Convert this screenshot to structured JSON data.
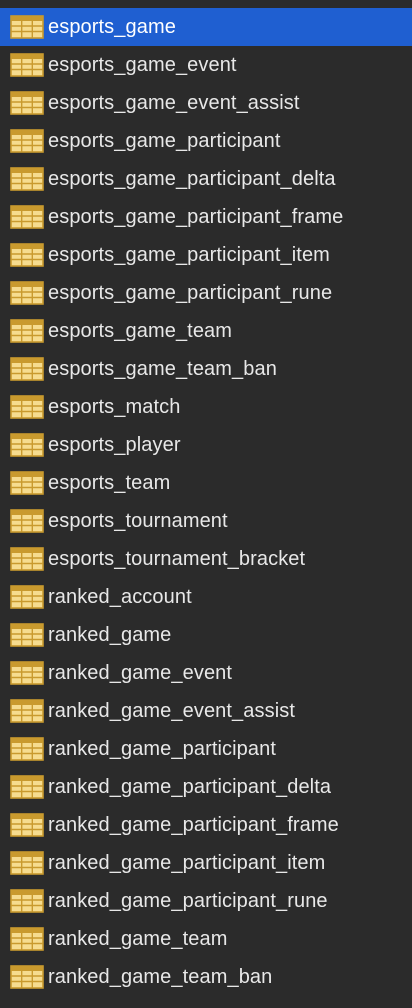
{
  "colors": {
    "background": "#2b2b2b",
    "selected": "#1f5fd1",
    "text": "#e8e8e8",
    "icon_fill": "#f6dc8f",
    "icon_grid": "#c99a2e"
  },
  "selected_index": 0,
  "tables": [
    {
      "name": "esports_game",
      "icon": "table-icon"
    },
    {
      "name": "esports_game_event",
      "icon": "table-icon"
    },
    {
      "name": "esports_game_event_assist",
      "icon": "table-icon"
    },
    {
      "name": "esports_game_participant",
      "icon": "table-icon"
    },
    {
      "name": "esports_game_participant_delta",
      "icon": "table-icon"
    },
    {
      "name": "esports_game_participant_frame",
      "icon": "table-icon"
    },
    {
      "name": "esports_game_participant_item",
      "icon": "table-icon"
    },
    {
      "name": "esports_game_participant_rune",
      "icon": "table-icon"
    },
    {
      "name": "esports_game_team",
      "icon": "table-icon"
    },
    {
      "name": "esports_game_team_ban",
      "icon": "table-icon"
    },
    {
      "name": "esports_match",
      "icon": "table-icon"
    },
    {
      "name": "esports_player",
      "icon": "table-icon"
    },
    {
      "name": "esports_team",
      "icon": "table-icon"
    },
    {
      "name": "esports_tournament",
      "icon": "table-icon"
    },
    {
      "name": "esports_tournament_bracket",
      "icon": "table-icon"
    },
    {
      "name": "ranked_account",
      "icon": "table-icon"
    },
    {
      "name": "ranked_game",
      "icon": "table-icon"
    },
    {
      "name": "ranked_game_event",
      "icon": "table-icon"
    },
    {
      "name": "ranked_game_event_assist",
      "icon": "table-icon"
    },
    {
      "name": "ranked_game_participant",
      "icon": "table-icon"
    },
    {
      "name": "ranked_game_participant_delta",
      "icon": "table-icon"
    },
    {
      "name": "ranked_game_participant_frame",
      "icon": "table-icon"
    },
    {
      "name": "ranked_game_participant_item",
      "icon": "table-icon"
    },
    {
      "name": "ranked_game_participant_rune",
      "icon": "table-icon"
    },
    {
      "name": "ranked_game_team",
      "icon": "table-icon"
    },
    {
      "name": "ranked_game_team_ban",
      "icon": "table-icon"
    }
  ]
}
